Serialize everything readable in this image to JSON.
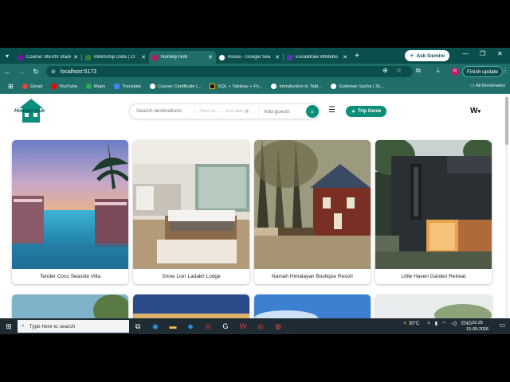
{
  "browser": {
    "tabs": [
      {
        "label": "Course: MERN Stack",
        "color": "#6a1b9a",
        "active": false
      },
      {
        "label": "Internship Data | Cl",
        "color": "#2e7d32",
        "active": false
      },
      {
        "label": "Homely Hub",
        "color": "#c2185b",
        "active": true
      },
      {
        "label": "house - Google Sea",
        "color": "#ffffff",
        "active": false
      },
      {
        "label": "Excalidraw Whitebo",
        "color": "#5e35b1",
        "active": false
      }
    ],
    "ask_gemini": "Ask Gemini",
    "url": "localhost:5173",
    "finish_update": "Finish update",
    "profile_initial": "R",
    "bookmarks": [
      {
        "label": "Gmail",
        "color": "#ea4335"
      },
      {
        "label": "YouTube",
        "color": "#ff0000"
      },
      {
        "label": "Maps",
        "color": "#34a853"
      },
      {
        "label": "Translate",
        "color": "#4285f4"
      },
      {
        "label": "Course Certificate |...",
        "color": "#ffffff"
      },
      {
        "label": "SQL + Tableau + Py...",
        "color": "#fbbc05"
      },
      {
        "label": "Introduction to Tabl...",
        "color": "#ffffff"
      },
      {
        "label": "Goldman Sachs | St...",
        "color": "#ffffff"
      }
    ],
    "all_bookmarks": "All Bookmarks"
  },
  "header": {
    "logo_text": "Homely Hub",
    "search_placeholder": "Search destinations",
    "start_date": "Start da... → End date",
    "guests_placeholder": "Add guests",
    "trip_genie": "Trip Genie",
    "lang_label": "W"
  },
  "listings": [
    {
      "name": "Tender Coco Seaside Villa"
    },
    {
      "name": "Snow Lion Ladakh Lodge"
    },
    {
      "name": "Namah Himalayan Boutique Resort"
    },
    {
      "name": "Little Haven Garden Retreat"
    }
  ],
  "taskbar": {
    "search_placeholder": "Type here to search",
    "weather": "30°C",
    "lang": "ENG",
    "time": "20:25",
    "date": "15-09-2026"
  }
}
